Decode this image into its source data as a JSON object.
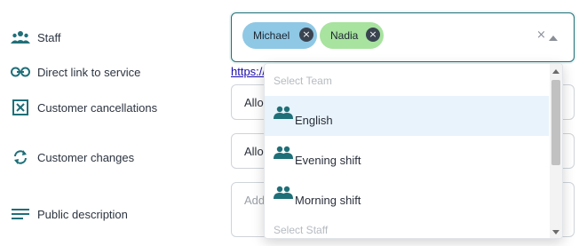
{
  "form": {
    "staff_label": "Staff",
    "direct_link_label": "Direct link to service",
    "customer_cancellations_label": "Customer cancellations",
    "customer_changes_label": "Customer changes",
    "public_description_label": "Public description",
    "direct_link_value": "https://",
    "cancellations_value": "Allo",
    "changes_value": "Allo",
    "description_placeholder": "Add"
  },
  "staff_select": {
    "chips": [
      "Michael",
      "Nadia"
    ],
    "clear_glyph": "×"
  },
  "dropdown": {
    "group_1": "Select Team",
    "items": [
      "English",
      "Evening shift",
      "Morning shift"
    ],
    "group_2": "Select Staff",
    "selected_index": 0
  },
  "colors": {
    "accent": "#1f6f78",
    "chip_michael": "#8fc8e5",
    "chip_nadia": "#a8e39f",
    "team_icon": "#1f6f78"
  },
  "icons": {
    "staff": "users-icon",
    "direct_link": "link-icon",
    "customer_cancellations": "close-box-icon",
    "customer_changes": "refresh-icon",
    "public_description": "text-lines-icon",
    "team": "team-icon"
  }
}
